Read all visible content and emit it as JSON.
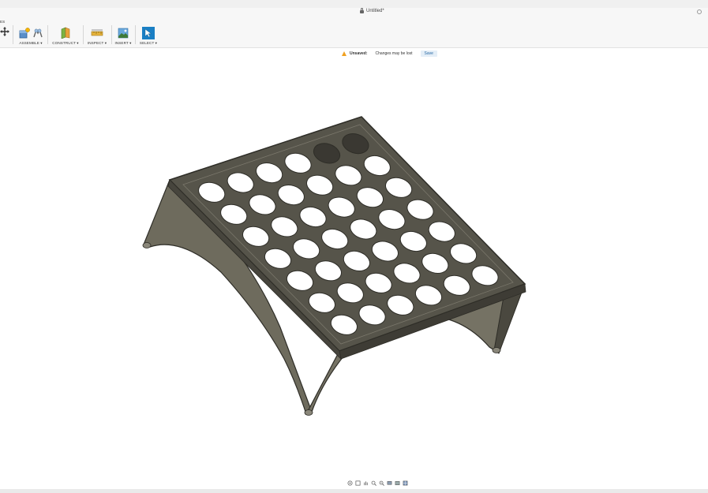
{
  "document": {
    "title": "Untitled*"
  },
  "toolbar": {
    "partial_label": "ES",
    "groups": [
      {
        "label": "ASSEMBLE ▾"
      },
      {
        "label": "CONSTRUCT ▾"
      },
      {
        "label": "INSPECT ▾"
      },
      {
        "label": "INSERT ▾"
      },
      {
        "label": "SELECT ▾"
      }
    ]
  },
  "notification": {
    "label": "Unsaved:",
    "message": "Changes may be lost",
    "save_label": "Save"
  },
  "colors": {
    "model_fill": "#56544a",
    "model_edge": "#2e2d27",
    "model_light": "#7a776b",
    "hole_fill": "#ffffff",
    "accent": "#2a6aa6",
    "warning": "#f0a020"
  },
  "viewport": {
    "model": "perforated-stand"
  },
  "navbar": {
    "icons": [
      "orbit-icon",
      "look-at-icon",
      "pan-icon",
      "zoom-icon",
      "fit-icon",
      "display-settings-icon",
      "visual-style-icon",
      "grid-icon"
    ]
  }
}
